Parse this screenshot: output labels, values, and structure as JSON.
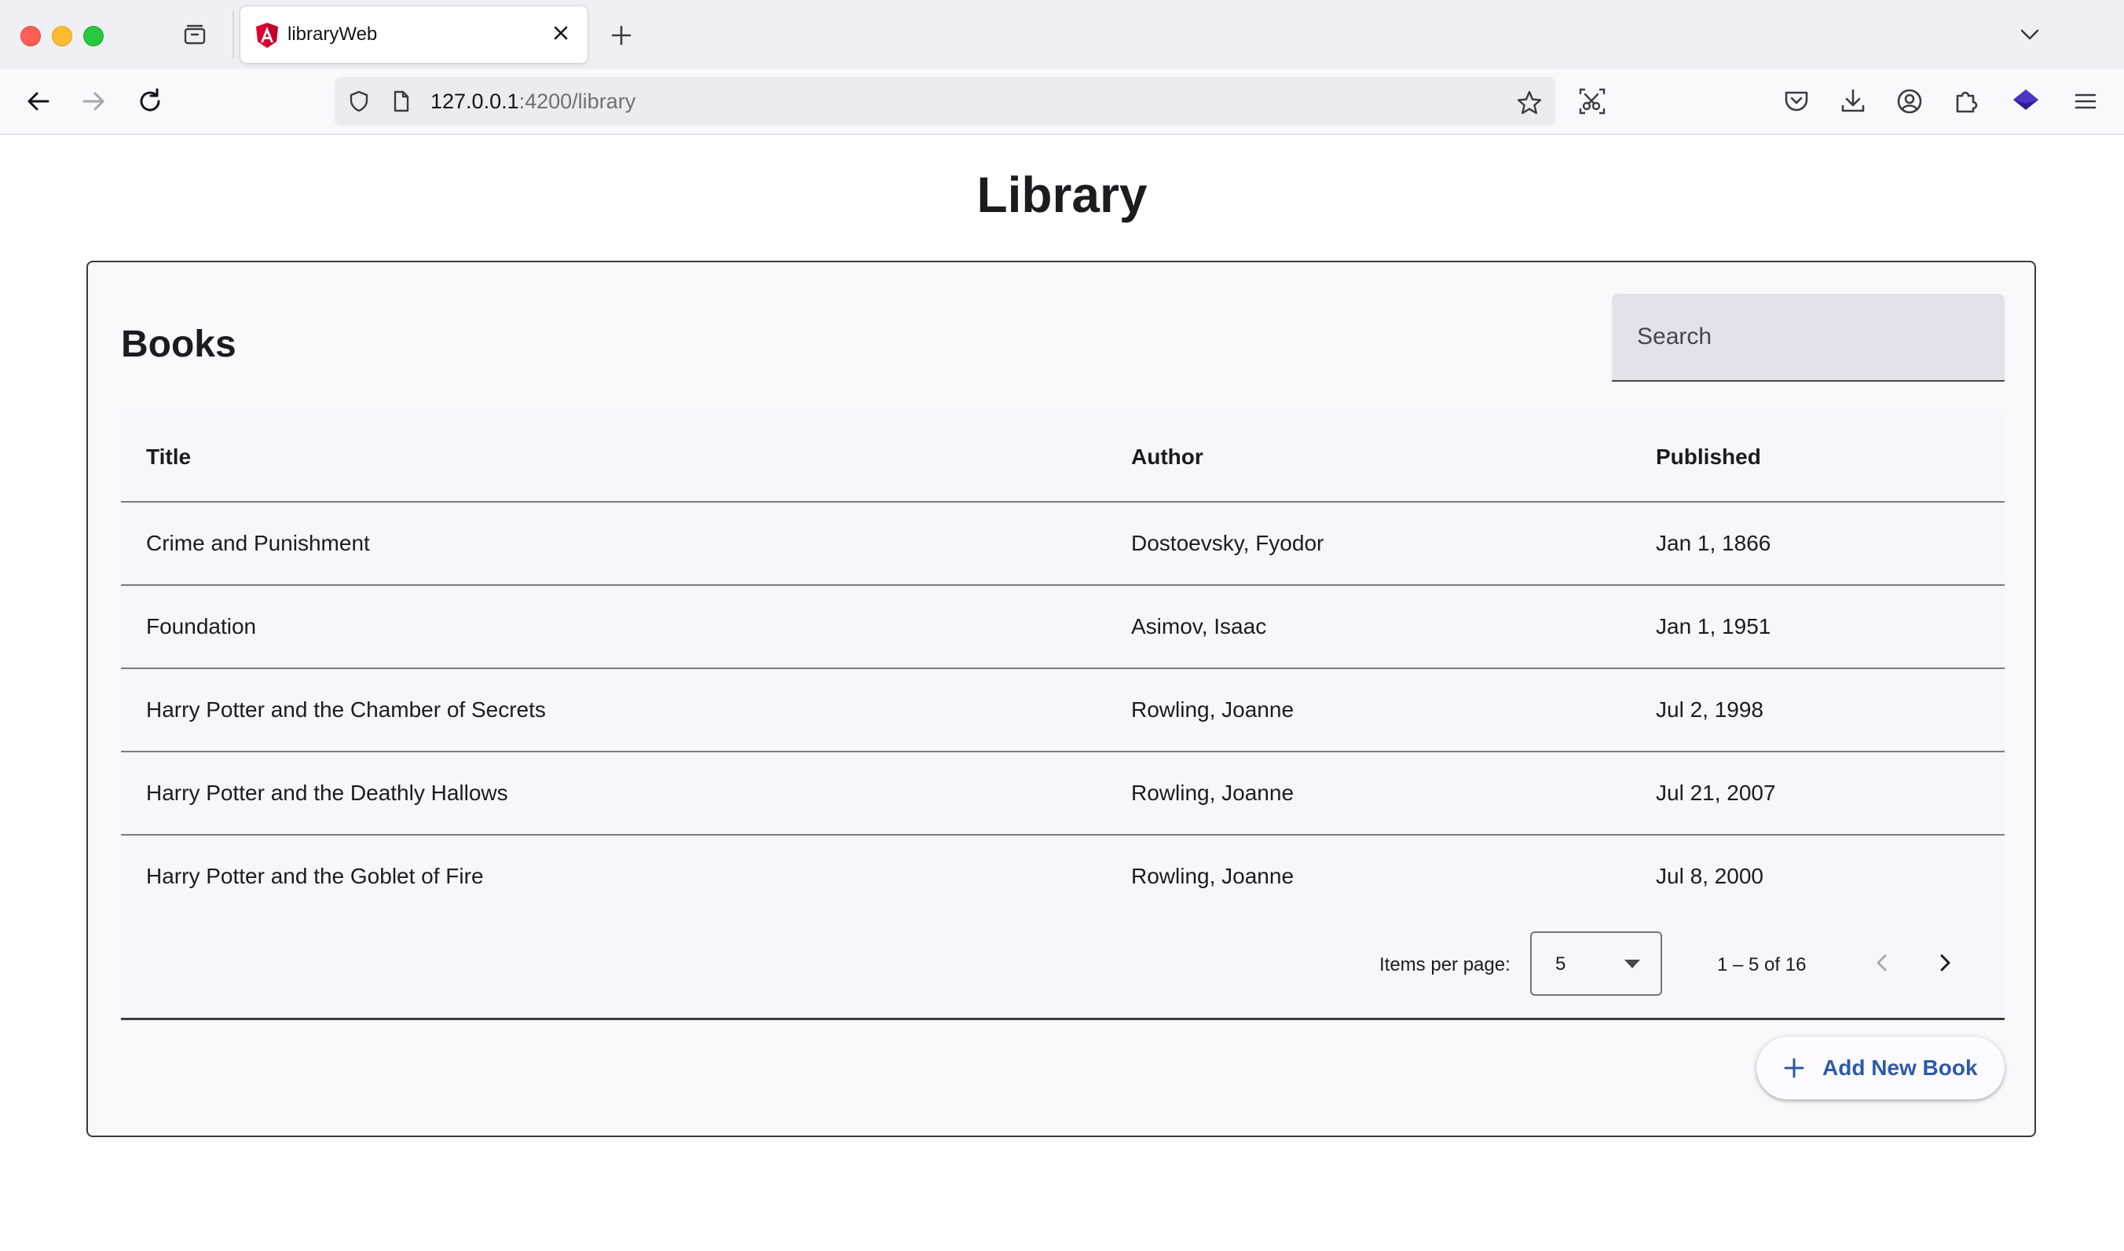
{
  "browser": {
    "tab_title": "libraryWeb",
    "url_host": "127.0.0.1",
    "url_rest": ":4200/library"
  },
  "page": {
    "title": "Library",
    "section_title": "Books",
    "search_placeholder": "Search"
  },
  "table": {
    "headers": [
      "Title",
      "Author",
      "Published"
    ],
    "rows": [
      [
        "Crime and Punishment",
        "Dostoevsky, Fyodor",
        "Jan 1, 1866"
      ],
      [
        "Foundation",
        "Asimov, Isaac",
        "Jan 1, 1951"
      ],
      [
        "Harry Potter and the Chamber of Secrets",
        "Rowling, Joanne",
        "Jul 2, 1998"
      ],
      [
        "Harry Potter and the Deathly Hallows",
        "Rowling, Joanne",
        "Jul 21, 2007"
      ],
      [
        "Harry Potter and the Goblet of Fire",
        "Rowling, Joanne",
        "Jul 8, 2000"
      ]
    ]
  },
  "paginator": {
    "items_per_page_label": "Items per page:",
    "page_size": "5",
    "range_label": "1 – 5 of 16"
  },
  "actions": {
    "add_book_label": "Add New Book"
  },
  "colors": {
    "accent": "#2d5aa8",
    "favicon": "#dd0031"
  }
}
